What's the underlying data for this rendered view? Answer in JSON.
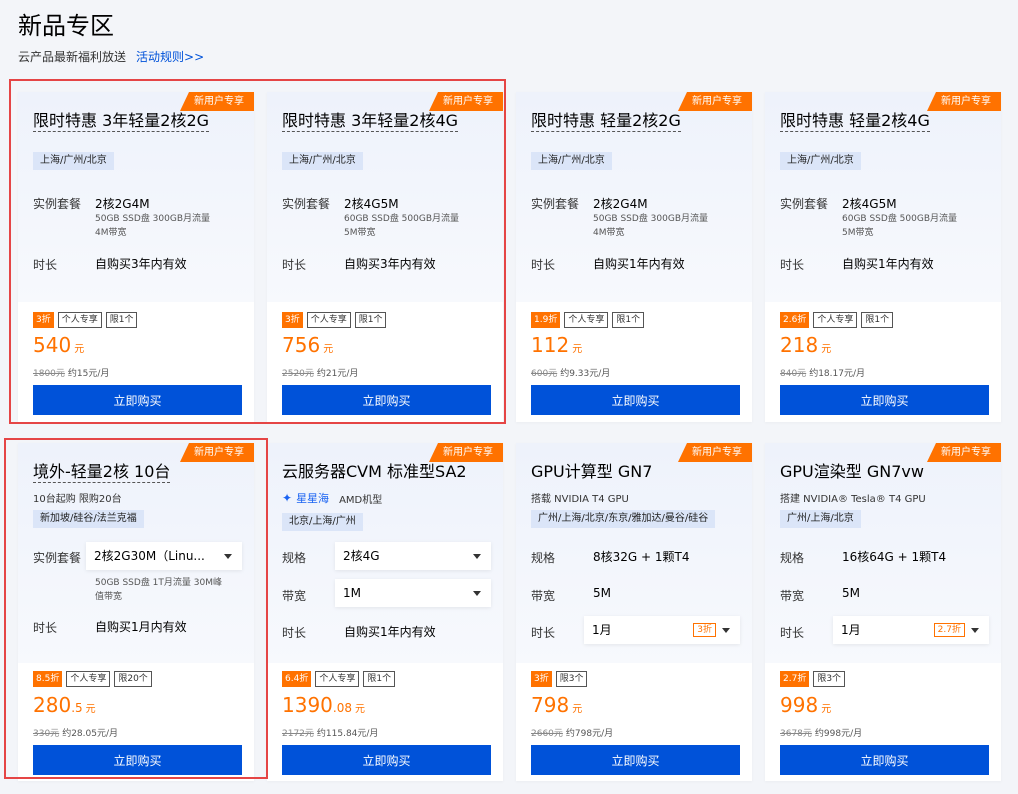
{
  "page": {
    "title": "新品专区",
    "subtitle": "云产品最新福利放送",
    "rules_link": "活动规则>>"
  },
  "colors": {
    "accent": "#ff7200",
    "primary": "#0052d9",
    "highlight": "#e54545"
  },
  "cards": [
    {
      "badge": "新用户专享",
      "title": "限时特惠 3年轻量2核2G",
      "region": "上海/广州/北京",
      "instance_label": "实例套餐",
      "instance_value": "2核2G4M",
      "instance_spec1": "50GB SSD盘 300GB月流量",
      "instance_spec2": "4M带宽",
      "duration_label": "时长",
      "duration_value": "自购买3年内有效",
      "discount": "3折",
      "tag1": "个人专享",
      "tag2": "限1个",
      "price": "540",
      "price_unit": "元",
      "original": "1800元",
      "monthly": "约15元/月",
      "buy": "立即购买"
    },
    {
      "badge": "新用户专享",
      "title": "限时特惠 3年轻量2核4G",
      "region": "上海/广州/北京",
      "instance_label": "实例套餐",
      "instance_value": "2核4G5M",
      "instance_spec1": "60GB SSD盘 500GB月流量",
      "instance_spec2": "5M带宽",
      "duration_label": "时长",
      "duration_value": "自购买3年内有效",
      "discount": "3折",
      "tag1": "个人专享",
      "tag2": "限1个",
      "price": "756",
      "price_unit": "元",
      "original": "2520元",
      "monthly": "约21元/月",
      "buy": "立即购买"
    },
    {
      "badge": "新用户专享",
      "title": "限时特惠 轻量2核2G",
      "region": "上海/广州/北京",
      "instance_label": "实例套餐",
      "instance_value": "2核2G4M",
      "instance_spec1": "50GB SSD盘 300GB月流量",
      "instance_spec2": "4M带宽",
      "duration_label": "时长",
      "duration_value": "自购买1年内有效",
      "discount": "1.9折",
      "tag1": "个人专享",
      "tag2": "限1个",
      "price": "112",
      "price_unit": "元",
      "original": "600元",
      "monthly": "约9.33元/月",
      "buy": "立即购买"
    },
    {
      "badge": "新用户专享",
      "title": "限时特惠 轻量2核4G",
      "region": "上海/广州/北京",
      "instance_label": "实例套餐",
      "instance_value": "2核4G5M",
      "instance_spec1": "60GB SSD盘 500GB月流量",
      "instance_spec2": "5M带宽",
      "duration_label": "时长",
      "duration_value": "自购买1年内有效",
      "discount": "2.6折",
      "tag1": "个人专享",
      "tag2": "限1个",
      "price": "218",
      "price_unit": "元",
      "original": "840元",
      "monthly": "约18.17元/月",
      "buy": "立即购买"
    },
    {
      "badge": "新用户专享",
      "title": "境外-轻量2核 10台",
      "subline": "10台起购 限购20台",
      "region": "新加坡/硅谷/法兰克福",
      "instance_label": "实例套餐",
      "instance_select": "2核2G30M（Linu...",
      "instance_spec1": "50GB SSD盘 1T月流量 30M峰",
      "instance_spec2": "值带宽",
      "duration_label": "时长",
      "duration_value": "自购买1月内有效",
      "discount": "8.5折",
      "tag1": "个人专享",
      "tag2": "限20个",
      "price": "280",
      "price_dec": ".5",
      "price_unit": "元",
      "original": "330元",
      "monthly": "约28.05元/月",
      "buy": "立即购买"
    },
    {
      "badge": "新用户专享",
      "title": "云服务器CVM 标准型SA2",
      "subline_brand": "星星海",
      "subline": "AMD机型",
      "region": "北京/上海/广州",
      "spec_label": "规格",
      "spec_select": "2核4G",
      "bw_label": "带宽",
      "bw_select": "1M",
      "duration_label": "时长",
      "duration_value": "自购买1年内有效",
      "discount": "6.4折",
      "tag1": "个人专享",
      "tag2": "限1个",
      "price": "1390",
      "price_dec": ".08",
      "price_unit": "元",
      "original": "2172元",
      "monthly": "约115.84元/月",
      "buy": "立即购买"
    },
    {
      "badge": "新用户专享",
      "title": "GPU计算型 GN7",
      "subline": "搭载 NVIDIA T4 GPU",
      "region": "广州/上海/北京/东京/雅加达/曼谷/硅谷",
      "spec_label": "规格",
      "spec_value": "8核32G + 1颗T4",
      "bw_label": "带宽",
      "bw_value": "5M",
      "duration_label": "时长",
      "duration_select": "1月",
      "duration_disc": "3折",
      "discount": "3折",
      "tag2": "限3个",
      "price": "798",
      "price_unit": "元",
      "original": "2660元",
      "monthly": "约798元/月",
      "buy": "立即购买"
    },
    {
      "badge": "新用户专享",
      "title": "GPU渲染型 GN7vw",
      "subline": "搭建 NVIDIA® Tesla® T4 GPU",
      "region": "广州/上海/北京",
      "spec_label": "规格",
      "spec_value": "16核64G + 1颗T4",
      "bw_label": "带宽",
      "bw_value": "5M",
      "duration_label": "时长",
      "duration_select": "1月",
      "duration_disc": "2.7折",
      "discount": "2.7折",
      "tag2": "限3个",
      "price": "998",
      "price_unit": "元",
      "original": "3678元",
      "monthly": "约998元/月",
      "buy": "立即购买"
    }
  ]
}
